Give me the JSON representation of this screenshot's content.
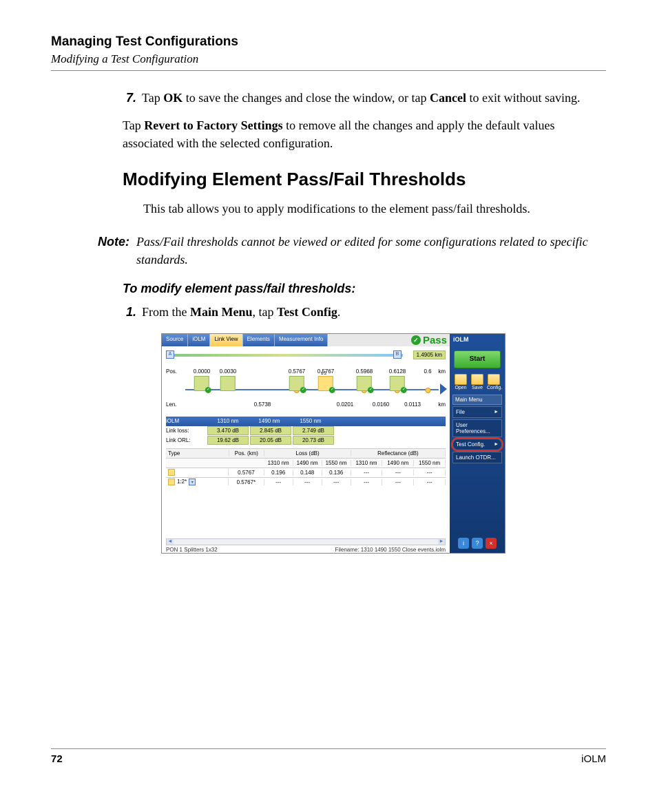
{
  "header": {
    "title": "Managing Test Configurations",
    "subtitle": "Modifying a Test Configuration"
  },
  "step7": {
    "num": "7.",
    "pre": "Tap ",
    "b1": "OK",
    "mid": " to save the changes and close the window, or tap ",
    "b2": "Cancel",
    "post": " to exit without saving."
  },
  "revert": {
    "pre": "Tap ",
    "b": "Revert to Factory Settings",
    "post": " to remove all the changes and apply the default values associated with the selected configuration."
  },
  "h2": "Modifying Element Pass/Fail Thresholds",
  "intro": "This tab allows you to apply modifications to the element pass/fail thresholds.",
  "note": {
    "label": "Note:",
    "text": "Pass/Fail thresholds cannot be viewed or edited for some configurations related to specific standards."
  },
  "proc_title": "To modify element pass/fail thresholds:",
  "step1": {
    "num": "1.",
    "pre": "From the ",
    "b1": "Main Menu",
    "mid": ", tap ",
    "b2": "Test Config",
    "post": "."
  },
  "footer": {
    "page": "72",
    "product": "iOLM"
  },
  "shot": {
    "tabs": [
      "Source",
      "iOLM",
      "Link View",
      "Elements",
      "Measurement Info"
    ],
    "active_tab_index": 2,
    "pass_label": "Pass",
    "link_km": "1.4905 km",
    "endpoint_a": "A",
    "endpoint_b": "B",
    "pos_label": "Pos.",
    "len_label": "Len.",
    "km_unit": "km",
    "positions": [
      "0.0000",
      "0.0030",
      "0.5767",
      "0.5767",
      "0.5968",
      "0.6128",
      "0.6"
    ],
    "lengths": [
      "0.5738",
      "0.0201",
      "0.0160",
      "0.0113"
    ],
    "splitter_label": "1:2",
    "wavelength_header": "iOLM",
    "wavelengths": [
      "1310 nm",
      "1490 nm",
      "1550 nm"
    ],
    "link_loss_label": "Link loss:",
    "link_loss": [
      "3.470 dB",
      "2.845 dB",
      "2.749 dB"
    ],
    "link_orl_label": "Link ORL:",
    "link_orl": [
      "19.62 dB",
      "20.05 dB",
      "20.73 dB"
    ],
    "table_headers": {
      "type": "Type",
      "pos": "Pos. (km)",
      "loss": "Loss (dB)",
      "refl": "Reflectance (dB)"
    },
    "table_sub": [
      "1310 nm",
      "1490 nm",
      "1550 nm",
      "1310 nm",
      "1490 nm",
      "1550 nm"
    ],
    "rows": [
      {
        "type": "",
        "pos": "0.5767",
        "loss": [
          "0.196",
          "0.148",
          "0.136"
        ],
        "refl": [
          "---",
          "---",
          "---"
        ]
      },
      {
        "type": "1:2*",
        "pos": "0.5767*",
        "loss": [
          "---",
          "---",
          "---"
        ],
        "refl": [
          "---",
          "---",
          "---"
        ]
      }
    ],
    "status_left": "PON 1 Splitters 1x32",
    "status_right": "Filename: 1310 1490 1550 Close events.iolm",
    "side": {
      "title": "iOLM",
      "start": "Start",
      "icons": [
        {
          "name": "open-icon",
          "label": "Open"
        },
        {
          "name": "save-icon",
          "label": "Save"
        },
        {
          "name": "config-icon",
          "label": "Config."
        }
      ],
      "menu_header": "Main Menu",
      "items": [
        {
          "label": "File",
          "arrow": true,
          "hl": false
        },
        {
          "label": "User Preferences...",
          "arrow": false,
          "hl": false
        },
        {
          "label": "Test Config.",
          "arrow": true,
          "hl": true
        },
        {
          "label": "Launch OTDR...",
          "arrow": false,
          "hl": false
        }
      ],
      "bottom": [
        "i",
        "?",
        "×"
      ]
    }
  }
}
